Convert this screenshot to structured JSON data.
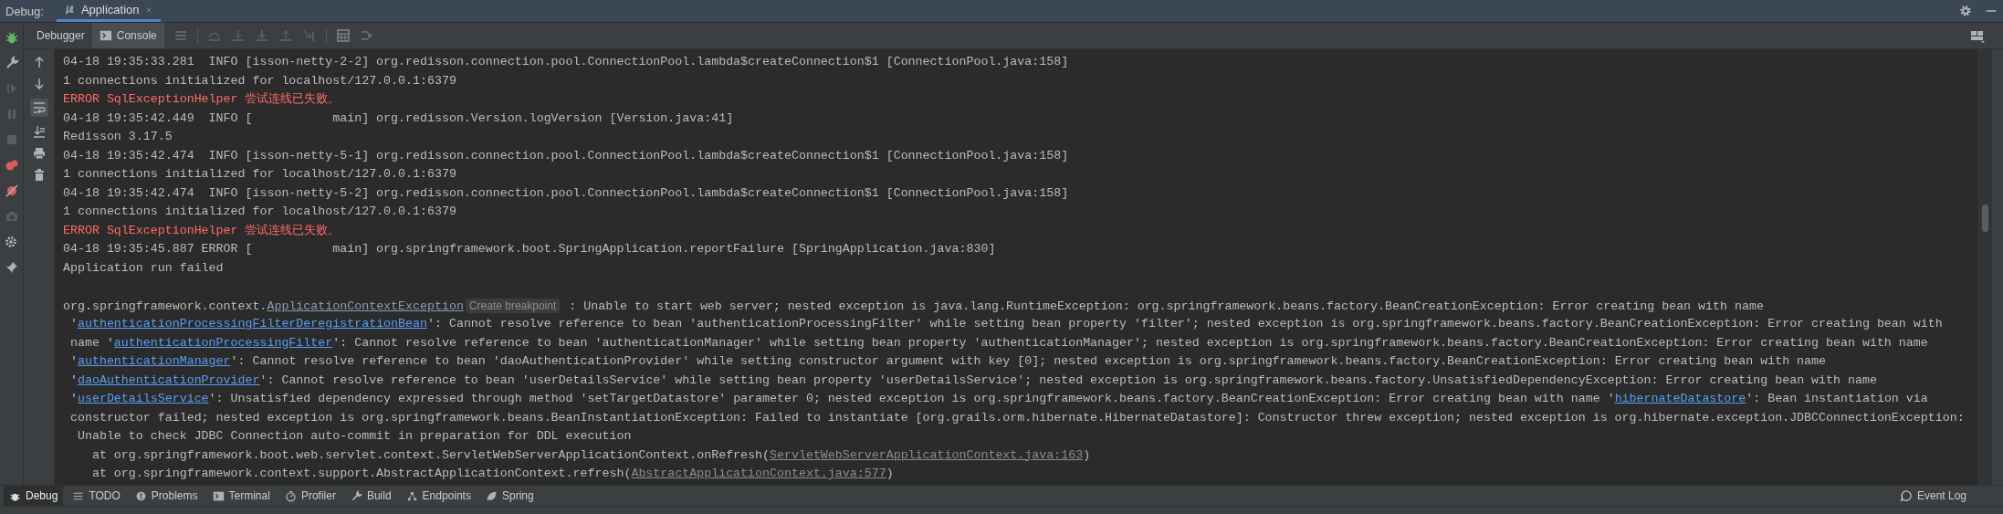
{
  "header": {
    "label": "Debug:",
    "tab": "Application"
  },
  "debug_tabs": [
    {
      "label": "Debugger",
      "selected": false
    },
    {
      "label": "Console",
      "selected": true
    }
  ],
  "console_lines": [
    {
      "kind": "normal",
      "segments": [
        {
          "kind": "plain",
          "text": "04-18 19:35:33.281  INFO [isson-netty-2-2] org.redisson.connection.pool.ConnectionPool.lambda$createConnection$1 [ConnectionPool.java:158]"
        }
      ]
    },
    {
      "kind": "normal",
      "segments": [
        {
          "kind": "plain",
          "text": "1 connections initialized for localhost/127.0.0.1:6379"
        }
      ]
    },
    {
      "kind": "error",
      "segments": [
        {
          "kind": "plain",
          "text": "ERROR SqlExceptionHelper 尝试连线已失败。"
        }
      ]
    },
    {
      "kind": "normal",
      "segments": [
        {
          "kind": "plain",
          "text": "04-18 19:35:42.449  INFO [           main] org.redisson.Version.logVersion [Version.java:41]"
        }
      ]
    },
    {
      "kind": "normal",
      "segments": [
        {
          "kind": "plain",
          "text": "Redisson 3.17.5"
        }
      ]
    },
    {
      "kind": "normal",
      "segments": [
        {
          "kind": "plain",
          "text": "04-18 19:35:42.474  INFO [isson-netty-5-1] org.redisson.connection.pool.ConnectionPool.lambda$createConnection$1 [ConnectionPool.java:158]"
        }
      ]
    },
    {
      "kind": "normal",
      "segments": [
        {
          "kind": "plain",
          "text": "1 connections initialized for localhost/127.0.0.1:6379"
        }
      ]
    },
    {
      "kind": "normal",
      "segments": [
        {
          "kind": "plain",
          "text": "04-18 19:35:42.474  INFO [isson-netty-5-2] org.redisson.connection.pool.ConnectionPool.lambda$createConnection$1 [ConnectionPool.java:158]"
        }
      ]
    },
    {
      "kind": "normal",
      "segments": [
        {
          "kind": "plain",
          "text": "1 connections initialized for localhost/127.0.0.1:6379"
        }
      ]
    },
    {
      "kind": "error",
      "segments": [
        {
          "kind": "plain",
          "text": "ERROR SqlExceptionHelper 尝试连线已失败。"
        }
      ]
    },
    {
      "kind": "normal",
      "segments": [
        {
          "kind": "plain",
          "text": "04-18 19:35:45.887 ERROR [           main] org.springframework.boot.SpringApplication.reportFailure [SpringApplication.java:830]"
        }
      ]
    },
    {
      "kind": "normal",
      "segments": [
        {
          "kind": "plain",
          "text": "Application run failed"
        }
      ]
    },
    {
      "kind": "normal"
    },
    {
      "kind": "normal",
      "segments": [
        {
          "kind": "plain",
          "text": "org.springframework.context."
        },
        {
          "kind": "class-link",
          "text": "ApplicationContextException"
        },
        {
          "kind": "hint",
          "text": "Create breakpoint"
        },
        {
          "kind": "plain",
          "text": " : Unable to start web server; nested exception is java.lang.RuntimeException: org.springframework.beans.factory.BeanCreationException: Error creating bean with name"
        }
      ]
    },
    {
      "kind": "normal",
      "segments": [
        {
          "kind": "plain",
          "text": " '"
        },
        {
          "kind": "link",
          "text": "authenticationProcessingFilterDeregistrationBean"
        },
        {
          "kind": "plain",
          "text": "': Cannot resolve reference to bean 'authenticationProcessingFilter' while setting bean property 'filter'; nested exception is org.springframework.beans.factory.BeanCreationException: Error creating bean with"
        }
      ]
    },
    {
      "kind": "normal",
      "segments": [
        {
          "kind": "plain",
          "text": " name '"
        },
        {
          "kind": "link",
          "text": "authenticationProcessingFilter"
        },
        {
          "kind": "plain",
          "text": "': Cannot resolve reference to bean 'authenticationManager' while setting bean property 'authenticationManager'; nested exception is org.springframework.beans.factory.BeanCreationException: Error creating bean with name"
        }
      ]
    },
    {
      "kind": "normal",
      "segments": [
        {
          "kind": "plain",
          "text": " '"
        },
        {
          "kind": "link",
          "text": "authenticationManager"
        },
        {
          "kind": "plain",
          "text": "': Cannot resolve reference to bean 'daoAuthenticationProvider' while setting constructor argument with key [0]; nested exception is org.springframework.beans.factory.BeanCreationException: Error creating bean with name"
        }
      ]
    },
    {
      "kind": "normal",
      "segments": [
        {
          "kind": "plain",
          "text": " '"
        },
        {
          "kind": "link",
          "text": "daoAuthenticationProvider"
        },
        {
          "kind": "plain",
          "text": "': Cannot resolve reference to bean 'userDetailsService' while setting bean property 'userDetailsService'; nested exception is org.springframework.beans.factory.UnsatisfiedDependencyException: Error creating bean with name"
        }
      ]
    },
    {
      "kind": "normal",
      "segments": [
        {
          "kind": "plain",
          "text": " '"
        },
        {
          "kind": "link",
          "text": "userDetailsService"
        },
        {
          "kind": "plain",
          "text": "': Unsatisfied dependency expressed through method 'setTargetDatastore' parameter 0; nested exception is org.springframework.beans.factory.BeanCreationException: Error creating bean with name '"
        },
        {
          "kind": "link",
          "text": "hibernateDatastore"
        },
        {
          "kind": "plain",
          "text": "': Bean instantiation via"
        }
      ]
    },
    {
      "kind": "normal",
      "segments": [
        {
          "kind": "plain",
          "text": " constructor failed; nested exception is org.springframework.beans.BeanInstantiationException: Failed to instantiate [org.grails.orm.hibernate.HibernateDatastore]: Constructor threw exception; nested exception is org.hibernate.exception.JDBCConnectionException:"
        }
      ]
    },
    {
      "kind": "normal",
      "segments": [
        {
          "kind": "plain",
          "text": "  Unable to check JDBC Connection auto-commit in preparation for DDL execution"
        }
      ]
    },
    {
      "kind": "normal",
      "segments": [
        {
          "kind": "plain",
          "text": "    at org.springframework.boot.web.servlet.context.ServletWebServerApplicationContext.onRefresh("
        },
        {
          "kind": "file-link",
          "text": "ServletWebServerApplicationContext.java:163"
        },
        {
          "kind": "plain",
          "text": ")"
        }
      ]
    },
    {
      "kind": "normal",
      "segments": [
        {
          "kind": "plain",
          "text": "    at org.springframework.context.support.AbstractApplicationContext.refresh("
        },
        {
          "kind": "file-link",
          "text": "AbstractApplicationContext.java:577"
        },
        {
          "kind": "plain",
          "text": ")"
        }
      ]
    }
  ],
  "tool_windows": [
    {
      "label": "Debug",
      "selected": true
    },
    {
      "label": "TODO",
      "selected": false
    },
    {
      "label": "Problems",
      "selected": false
    },
    {
      "label": "Terminal",
      "selected": false
    },
    {
      "label": "Profiler",
      "selected": false
    },
    {
      "label": "Build",
      "selected": false
    },
    {
      "label": "Endpoints",
      "selected": false
    },
    {
      "label": "Spring",
      "selected": false
    }
  ],
  "event_log": "Event Log"
}
